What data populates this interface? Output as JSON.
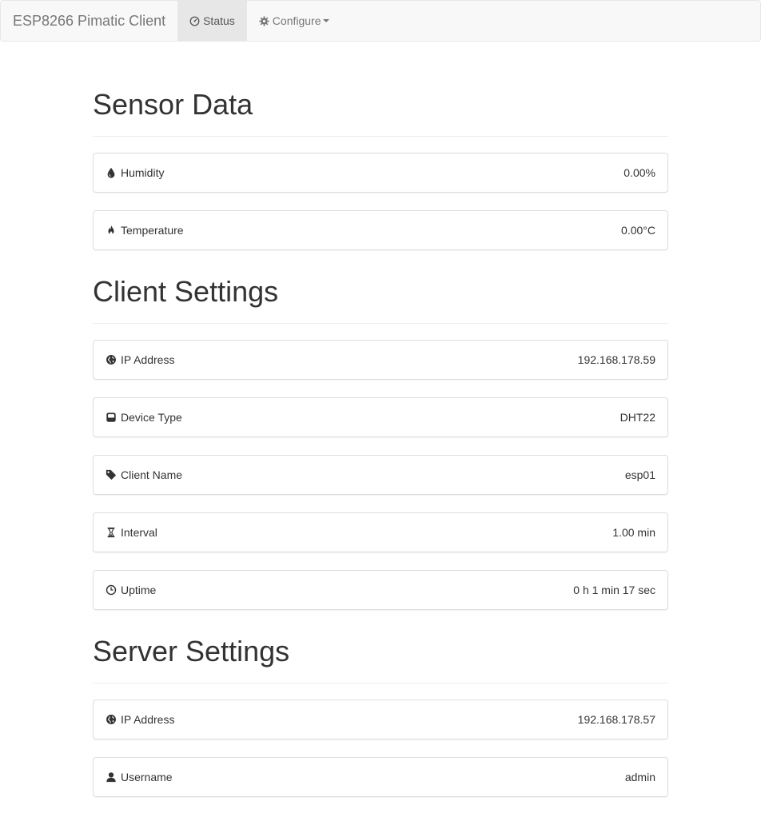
{
  "navbar": {
    "brand": "ESP8266 Pimatic Client",
    "status_label": "Status",
    "configure_label": "Configure"
  },
  "sensor": {
    "heading": "Sensor Data",
    "humidity": {
      "label": "Humidity",
      "value": "0.00%"
    },
    "temperature": {
      "label": "Temperature",
      "value": "0.00°C"
    }
  },
  "client": {
    "heading": "Client Settings",
    "ip": {
      "label": "IP Address",
      "value": "192.168.178.59"
    },
    "device_type": {
      "label": "Device Type",
      "value": "DHT22"
    },
    "name": {
      "label": "Client Name",
      "value": "esp01"
    },
    "interval": {
      "label": "Interval",
      "value": "1.00 min"
    },
    "uptime": {
      "label": "Uptime",
      "value": "0 h 1 min 17 sec"
    }
  },
  "server": {
    "heading": "Server Settings",
    "ip": {
      "label": "IP Address",
      "value": "192.168.178.57"
    },
    "username": {
      "label": "Username",
      "value": "admin"
    }
  },
  "icons": {
    "humidity": "tint-icon",
    "temperature": "fire-icon",
    "ip": "globe-icon",
    "device_type": "hdd-icon",
    "name": "tag-icon",
    "interval": "hourglass-icon",
    "uptime": "clock-icon",
    "username": "user-icon",
    "status": "dashboard-icon",
    "configure": "cog-icon"
  }
}
